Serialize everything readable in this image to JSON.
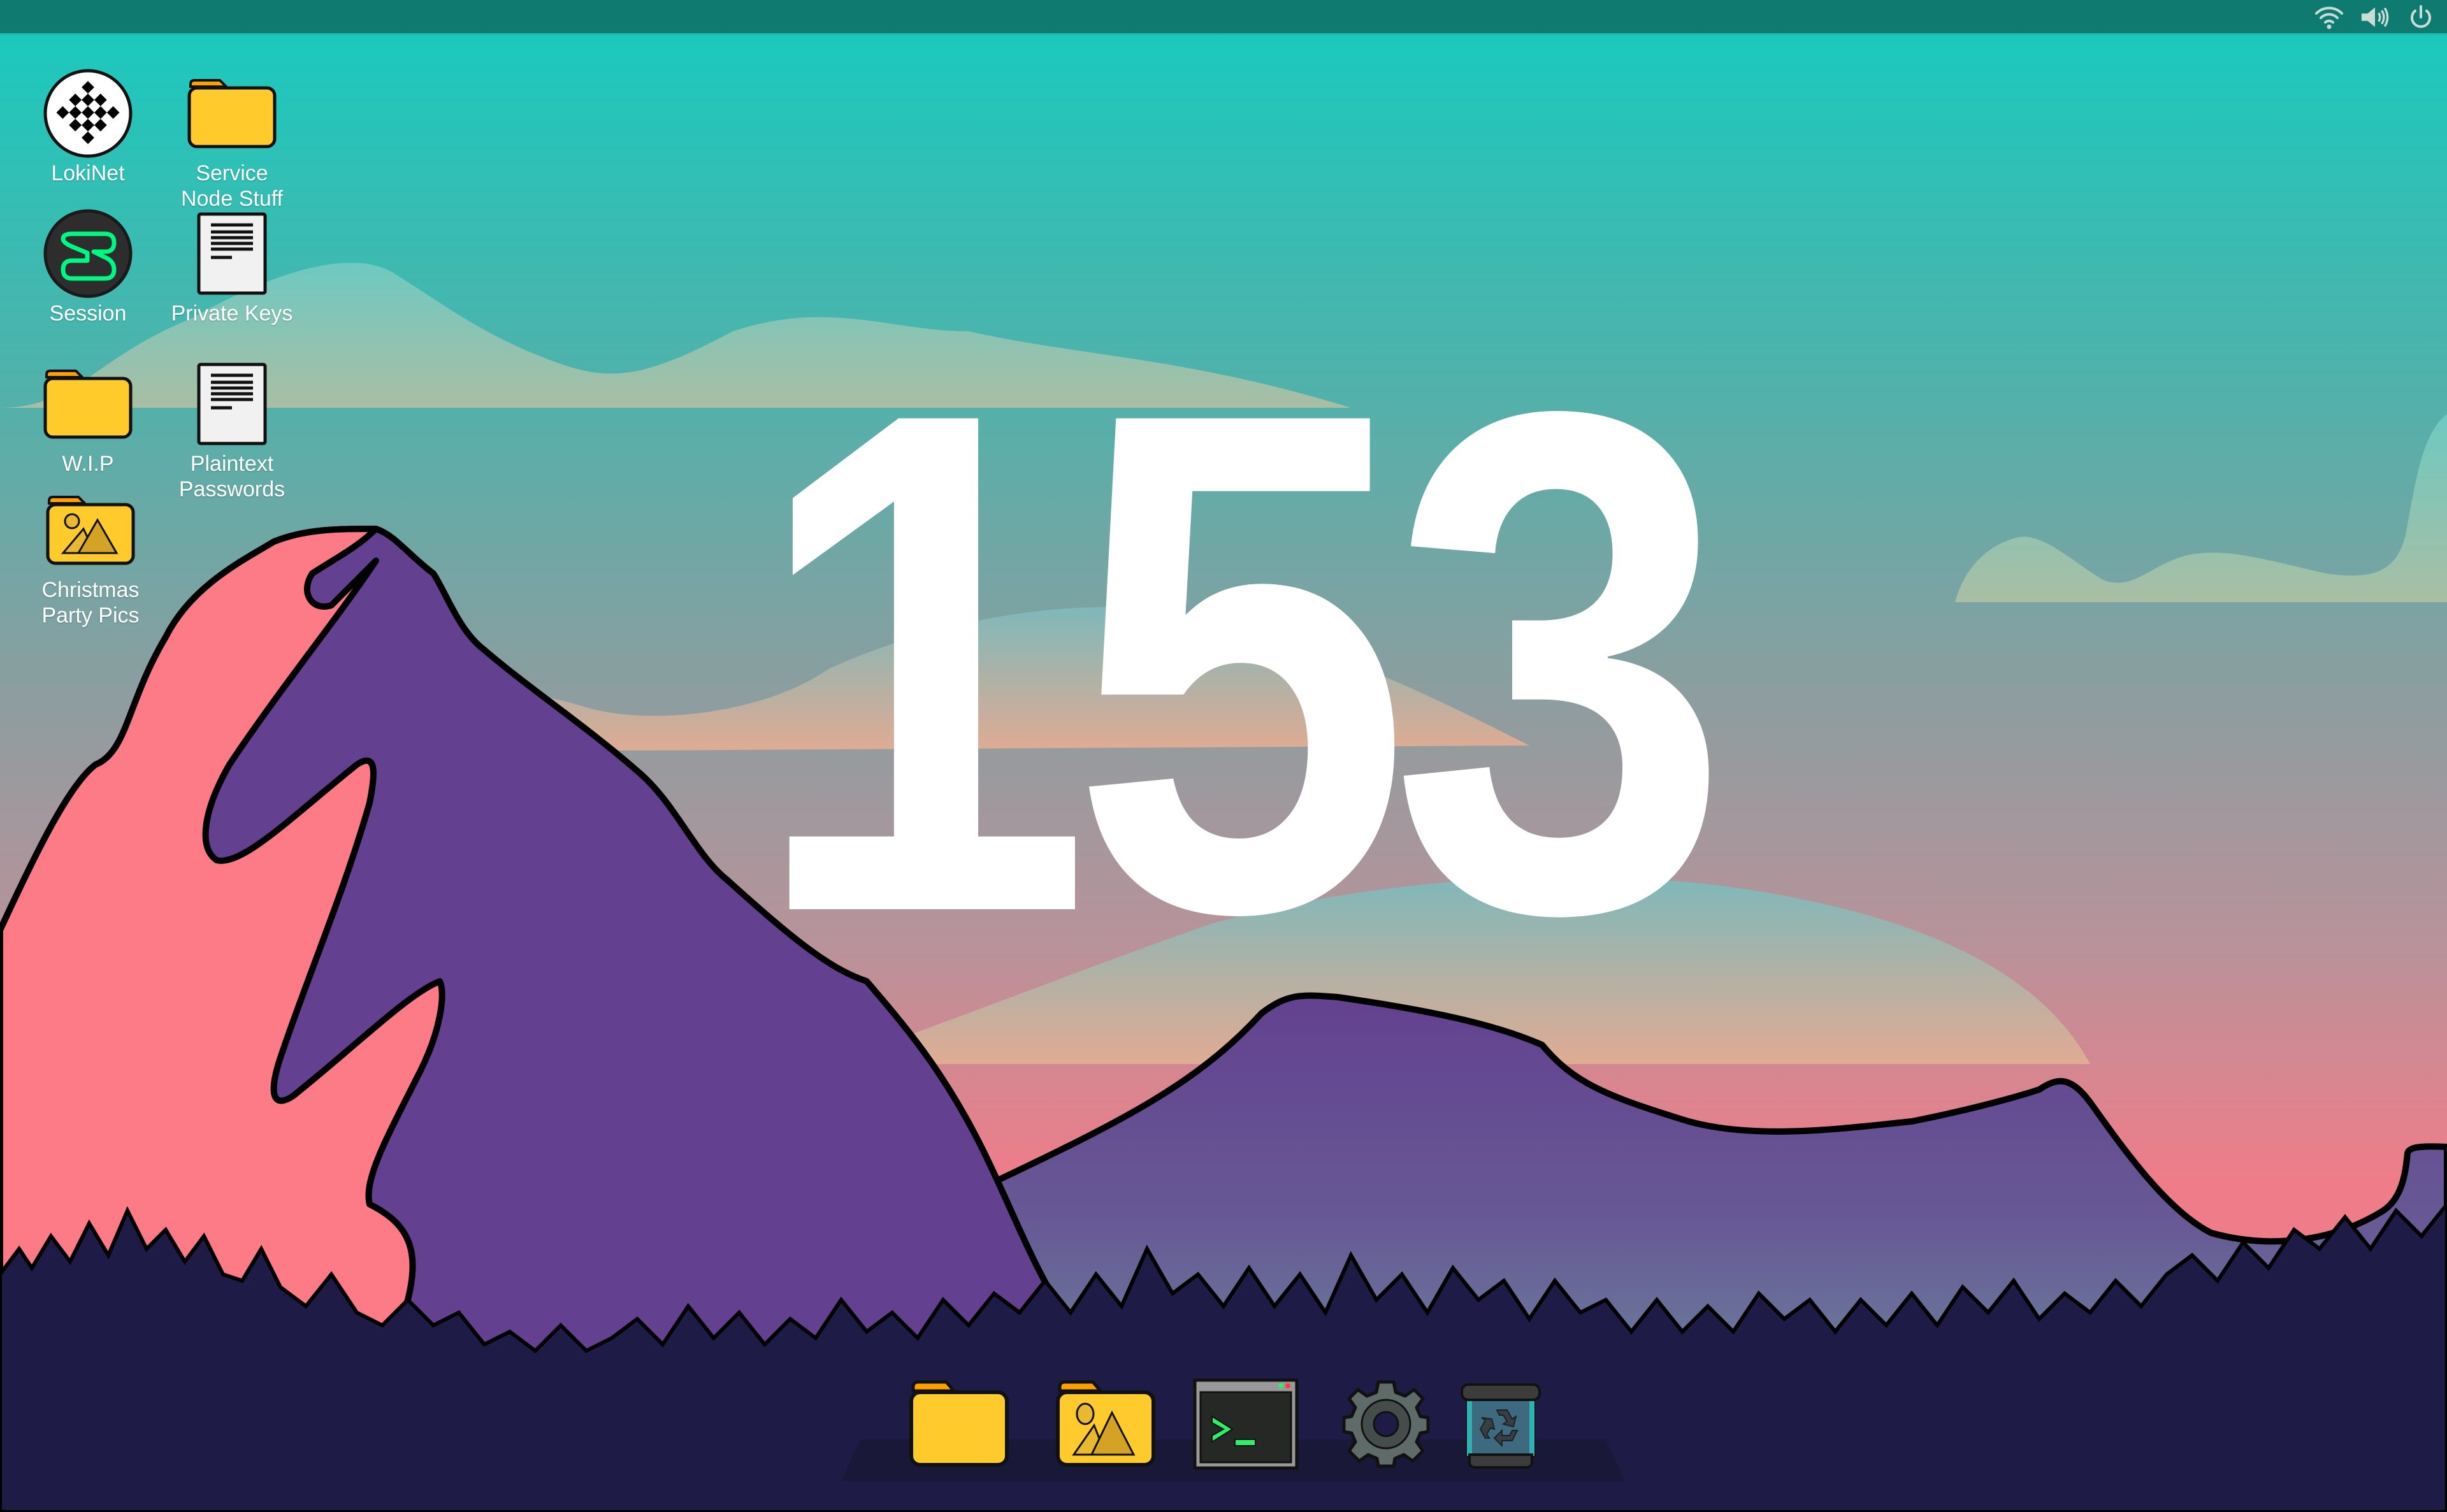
{
  "topbar": {
    "tray": [
      {
        "icon": "wifi-icon",
        "label": "Wi-Fi"
      },
      {
        "icon": "volume-icon",
        "label": "Volume"
      },
      {
        "icon": "power-icon",
        "label": "Power"
      }
    ]
  },
  "desktop": {
    "icons": [
      {
        "id": "lokinet",
        "label": "LokiNet",
        "icon": "lokinet-icon"
      },
      {
        "id": "service-node-stuff",
        "label": "Service Node Stuff",
        "icon": "folder-icon"
      },
      {
        "id": "session",
        "label": "Session",
        "icon": "session-icon"
      },
      {
        "id": "private-keys",
        "label": "Private Keys",
        "icon": "document-icon"
      },
      {
        "id": "wip",
        "label": "W.I.P",
        "icon": "folder-icon"
      },
      {
        "id": "plaintext-passwords",
        "label": "Plaintext Passwords",
        "icon": "document-icon"
      },
      {
        "id": "christmas-party-pics",
        "label": "Christmas Party Pics",
        "icon": "image-folder-icon"
      }
    ],
    "clock_text": "153"
  },
  "dock": {
    "items": [
      {
        "label": "Files",
        "icon": "folder-icon"
      },
      {
        "label": "Pictures",
        "icon": "image-folder-icon"
      },
      {
        "label": "Terminal",
        "icon": "terminal-icon"
      },
      {
        "label": "Settings",
        "icon": "gear-icon"
      },
      {
        "label": "Trash",
        "icon": "trash-icon"
      }
    ]
  },
  "colors": {
    "topbar": "#0f7a70",
    "sky_top": "#1cc6bb",
    "sky_bottom": "#f07a88",
    "mountain_purple": "#634190",
    "mountain_pink": "#fd7b87",
    "forest": "#1e1b47",
    "folder_yellow": "#ffca2c",
    "terminal_green": "#2df066"
  }
}
